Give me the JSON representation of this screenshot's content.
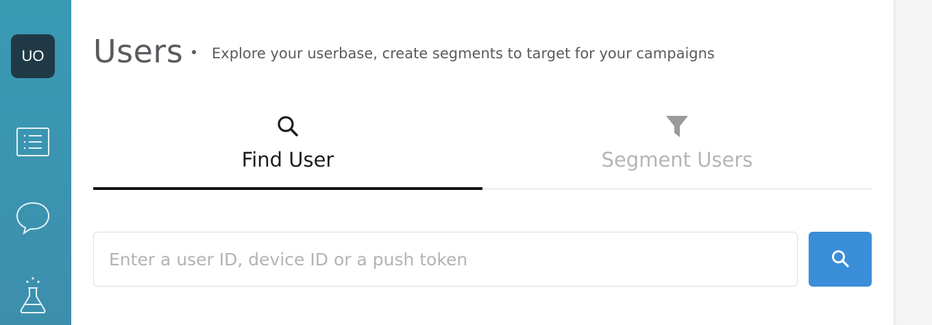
{
  "sidebar": {
    "avatar_initials": "UO",
    "items": [
      {
        "icon": "list-icon"
      },
      {
        "icon": "chat-bubble-icon"
      },
      {
        "icon": "flask-icon"
      }
    ]
  },
  "header": {
    "title": "Users",
    "subtitle": "Explore your userbase, create segments to target for your campaigns"
  },
  "tabs": [
    {
      "label": "Find User",
      "icon": "search-icon",
      "active": true
    },
    {
      "label": "Segment Users",
      "icon": "filter-icon",
      "active": false
    }
  ],
  "search": {
    "placeholder": "Enter a user ID, device ID or a push token",
    "value": "",
    "button_icon": "search-icon"
  },
  "colors": {
    "sidebar": "#3a9ab4",
    "avatar_bg": "#1f3a46",
    "accent_button": "#3a8ed8",
    "active_tab_text": "#1d1d1f",
    "inactive_tab_text": "#b5b5b8"
  }
}
